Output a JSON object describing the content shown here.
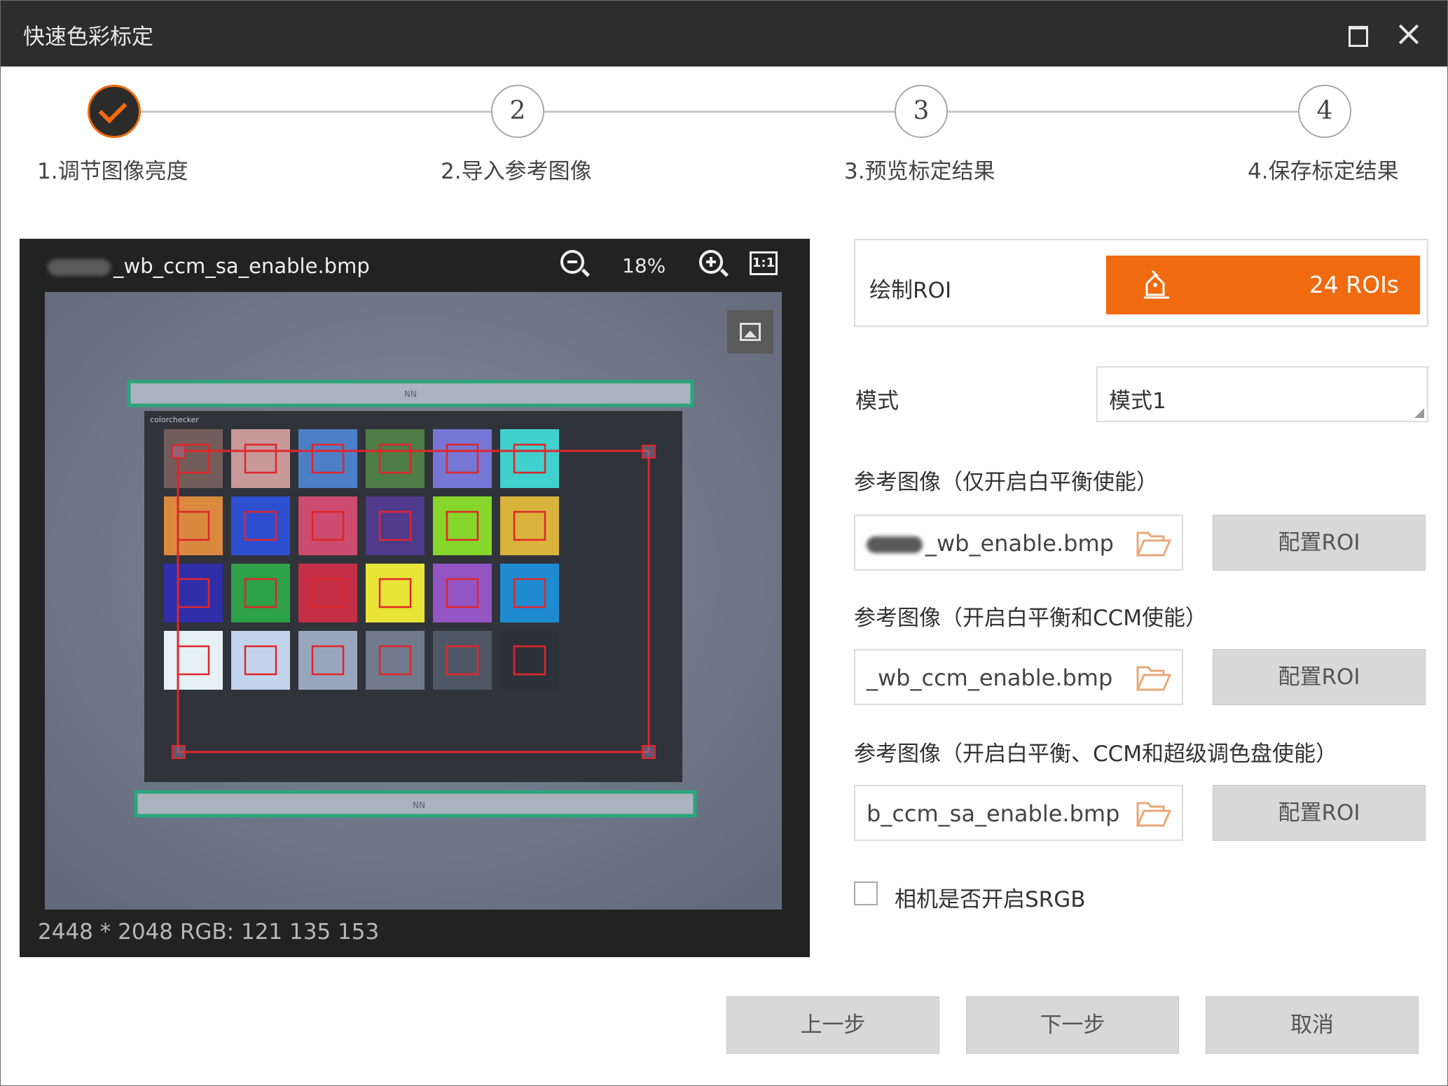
{
  "window": {
    "title": "快速色彩标定"
  },
  "steps": [
    {
      "number": "",
      "label": "1.调节图像亮度",
      "status": "done"
    },
    {
      "number": "2",
      "label": "2.导入参考图像"
    },
    {
      "number": "3",
      "label": "3.预览标定结果"
    },
    {
      "number": "4",
      "label": "4.保存标定结果"
    }
  ],
  "viewer": {
    "filename": "_wb_ccm_sa_enable.bmp",
    "zoom": "18%",
    "fit_label": "1:1",
    "info": "2448 * 2048    RGB: 121 135 153",
    "chart_top_label": "NN",
    "chart_bottom_label": "NN",
    "chart_brand": "colorchecker",
    "patch_colors": [
      "#735d5a",
      "#c79999",
      "#4d7fc7",
      "#4e7c45",
      "#7677d4",
      "#40d0cd",
      "#d98a3f",
      "#2e4fd0",
      "#cd4b6e",
      "#4f3a8c",
      "#86d62c",
      "#d9b33b",
      "#2f2ea8",
      "#2ea14a",
      "#c42f45",
      "#e9e536",
      "#9355c4",
      "#1e8bd0",
      "#e6f2f5",
      "#c2d4ec",
      "#98a6bd",
      "#707a8c",
      "#4f5766",
      "#2d3139"
    ]
  },
  "right_panel": {
    "roi_label": "绘制ROI",
    "roi_count": "24 ROIs",
    "mode_label": "模式",
    "mode_value": "模式1",
    "ref1_label": "参考图像（仅开启白平衡使能）",
    "ref1_file": "_wb_enable.bmp",
    "ref2_label": "参考图像（开启白平衡和CCM使能）",
    "ref2_file": "_wb_ccm_enable.bmp",
    "ref3_label": "参考图像（开启白平衡、CCM和超级调色盘使能）",
    "ref3_file": "b_ccm_sa_enable.bmp",
    "config_roi": "配置ROI",
    "srgb_label": "相机是否开启SRGB",
    "srgb_checked": false
  },
  "footer": {
    "prev": "上一步",
    "next": "下一步",
    "cancel": "取消"
  },
  "colors": {
    "accent": "#f06a0f",
    "titlebar": "#2d2d2d",
    "roi_outline": "#e0262a"
  }
}
